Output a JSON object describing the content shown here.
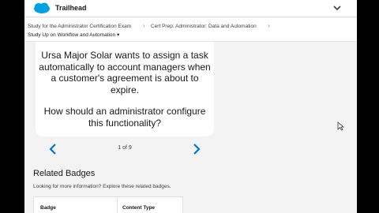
{
  "header": {
    "brand": "Trailhead",
    "logo_icon": "salesforce-cloud-icon",
    "menu_icon": "chevron-down-icon"
  },
  "breadcrumbs": {
    "item1": "Study for the Administrator Certification Exam",
    "item2": "Cert Prep: Administrator: Data and Automation",
    "item3": "Study Up on Workflow and Automation ▾"
  },
  "flashcard": {
    "line1": "Ursa Major Solar wants to assign a task automatically to account managers when a customer's agreement is about to expire.",
    "line2": "How should an administrator configure this functionality?"
  },
  "pager": {
    "text": "1 of 9",
    "prev_icon": "chevron-left-icon",
    "next_icon": "chevron-right-icon"
  },
  "related": {
    "title": "Related Badges",
    "subtitle": "Looking for more information? Explore these related badges.",
    "col_badge": "Badge",
    "col_content_type": "Content Type"
  },
  "colors": {
    "accent": "#0176d3",
    "brand_blue": "#00a1e0",
    "background": "#f3f3f3"
  }
}
